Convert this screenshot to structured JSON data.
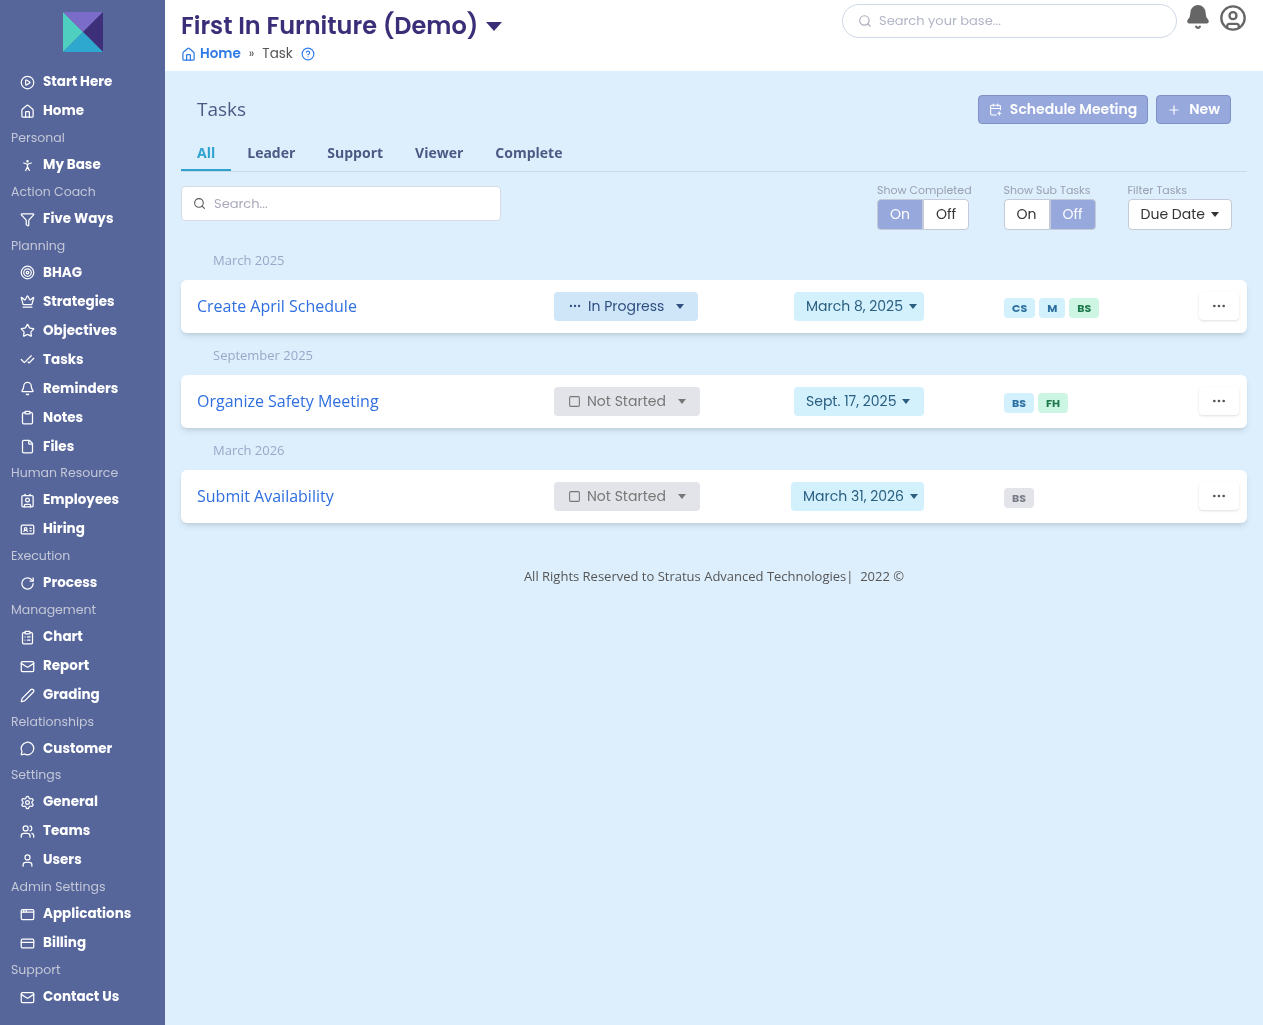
{
  "sidebar": {
    "sections": [
      {
        "items": [
          "Start Here",
          "Home"
        ]
      },
      {
        "heading": "Personal",
        "items": [
          "My Base"
        ]
      },
      {
        "heading": "Action Coach",
        "items": [
          "Five Ways"
        ]
      },
      {
        "heading": "Planning",
        "items": [
          "BHAG",
          "Strategies",
          "Objectives",
          "Tasks",
          "Reminders",
          "Notes",
          "Files"
        ]
      },
      {
        "heading": "Human Resource",
        "items": [
          "Employees",
          "Hiring"
        ]
      },
      {
        "heading": "Execution",
        "items": [
          "Process"
        ]
      },
      {
        "heading": "Management",
        "items": [
          "Chart",
          "Report",
          "Grading"
        ]
      },
      {
        "heading": "Relationships",
        "items": [
          "Customer"
        ]
      },
      {
        "heading": "Settings",
        "items": [
          "General",
          "Teams",
          "Users"
        ]
      },
      {
        "heading": "Admin Settings",
        "items": [
          "Applications",
          "Billing"
        ]
      },
      {
        "heading": "Support",
        "items": [
          "Contact Us"
        ]
      }
    ]
  },
  "header": {
    "title": "First In Furniture (Demo)",
    "breadcrumb": [
      "Home",
      "»",
      "Task"
    ],
    "search": {
      "placeholder": "Search your base..."
    }
  },
  "page": {
    "title": "Tasks",
    "buttons": [
      "Schedule Meeting",
      "New"
    ],
    "tabs": [
      {
        "label": "All",
        "selected": true
      },
      {
        "label": "Leader",
        "selected": false
      },
      {
        "label": "Support",
        "selected": false
      },
      {
        "label": "Viewer",
        "selected": false
      },
      {
        "label": "Complete",
        "selected": false
      }
    ],
    "search": {
      "placeholder": "Search..."
    },
    "toggles": [
      {
        "label": "Show Completed",
        "on_label": "On",
        "off_label": "Off",
        "on": true
      },
      {
        "label": "Show Sub Tasks",
        "on_label": "On",
        "off_label": "Off",
        "on": false
      }
    ],
    "filter": {
      "label": "Filter Tasks",
      "value": "Due Date"
    },
    "groups": [
      {
        "heading": "March 2025",
        "tasks": [
          {
            "name": "Create April Schedule",
            "status": {
              "kind": "in_progress",
              "label": "In Progress"
            },
            "due": "March 8, 2025",
            "tags": [
              {
                "text": "CS",
                "color": "#d3f0fd"
              },
              {
                "text": "M",
                "color": "#d3f0fd"
              },
              {
                "text": "BS",
                "color": "#cdf5e3"
              }
            ]
          }
        ]
      },
      {
        "heading": "September 2025",
        "tasks": [
          {
            "name": "Organize Safety Meeting",
            "status": {
              "kind": "not_started",
              "label": "Not Started"
            },
            "due": "Sept. 17, 2025",
            "tags": [
              {
                "text": "BS",
                "color": "#d3f0fd"
              },
              {
                "text": "FH",
                "color": "#cdf5e3"
              }
            ]
          }
        ]
      },
      {
        "heading": "March 2026",
        "tasks": [
          {
            "name": "Submit Availability",
            "status": {
              "kind": "not_started",
              "label": "Not Started"
            },
            "due": "March 31, 2026",
            "tags": [
              {
                "text": "BS",
                "color": "#e3e4e9"
              }
            ]
          }
        ]
      }
    ]
  },
  "footer": "All Rights Reserved to Stratus Advanced Technologies|  2022 ©"
}
